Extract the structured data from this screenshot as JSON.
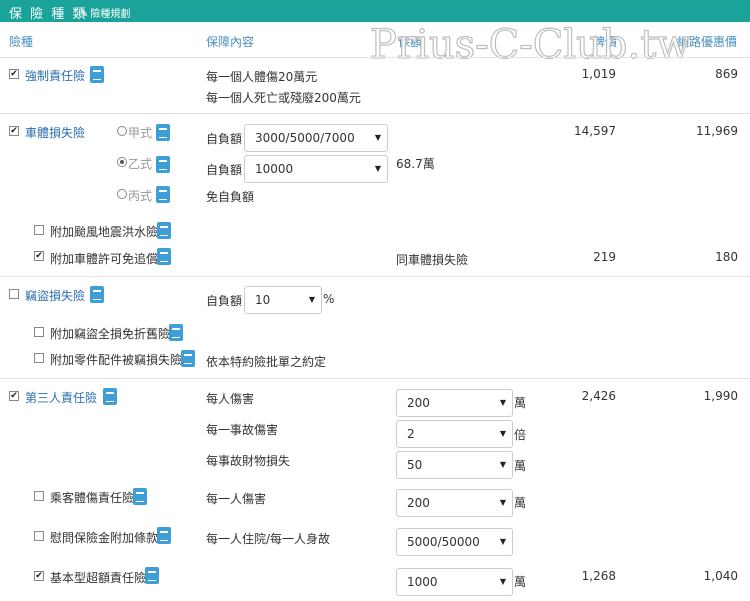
{
  "header": {
    "title": "保 險 種 類",
    "rule_icon": "wand-icon",
    "rule_label": "險種規劃"
  },
  "columns": {
    "kind": "險種",
    "content": "保障內容",
    "amount": "保額",
    "list_price": "牌價",
    "online_price": "網路優惠價"
  },
  "watermark": "Prius-C-Club.tw",
  "rows": {
    "compulsory": {
      "label": "強制責任險",
      "checked": true,
      "line1": "每一個人體傷20萬元",
      "line2": "每一個人死亡或殘廢200萬元",
      "list": "1,019",
      "online": "869"
    },
    "body": {
      "label": "車體損失險",
      "checked": true,
      "list": "14,597",
      "online": "11,969",
      "opt_a": {
        "label": "甲式",
        "selected": false,
        "ded_label": "自負額",
        "ded_value": "3000/5000/7000"
      },
      "opt_b": {
        "label": "乙式",
        "selected": true,
        "ded_label": "自負額",
        "ded_value": "10000",
        "amount": "68.7萬"
      },
      "opt_c": {
        "label": "丙式",
        "selected": false,
        "note": "免自負額"
      },
      "addon_typhoon": {
        "label": "附加颱風地震洪水險",
        "checked": false
      },
      "addon_waiver": {
        "label": "附加車體許可免追償",
        "checked": true,
        "amount": "同車體損失險",
        "list": "219",
        "online": "180"
      }
    },
    "theft": {
      "label": "竊盜損失險",
      "checked": false,
      "ded_label": "自負額",
      "ded_value": "10",
      "unit": "%",
      "addon_nodep": {
        "label": "附加竊盜全損免折舊險",
        "checked": false
      },
      "addon_parts": {
        "label": "附加零件配件被竊損失險",
        "checked": false,
        "note": "依本特約險批單之約定"
      }
    },
    "third": {
      "label": "第三人責任險",
      "checked": true,
      "list": "2,426",
      "online": "1,990",
      "per_person": {
        "label": "每人傷害",
        "value": "200",
        "unit": "萬"
      },
      "per_accident": {
        "label": "每一事故傷害",
        "value": "2",
        "unit": "倍"
      },
      "property": {
        "label": "每事故財物損失",
        "value": "50",
        "unit": "萬"
      }
    },
    "passenger": {
      "label": "乘客體傷責任險",
      "checked": false,
      "desc": "每一人傷害",
      "value": "200",
      "unit": "萬"
    },
    "condolence": {
      "label": "慰問保險金附加條款",
      "checked": false,
      "desc": "每一人住院/每一人身故",
      "value": "5000/50000"
    },
    "excess": {
      "label": "基本型超額責任險",
      "checked": true,
      "value": "1000",
      "unit": "萬",
      "list": "1,268",
      "online": "1,040"
    }
  }
}
